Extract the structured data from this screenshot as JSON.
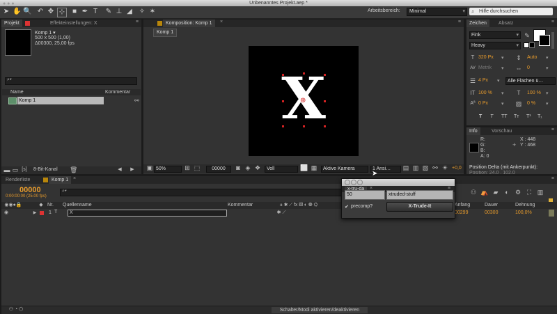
{
  "window": {
    "title": "Unbenanntes Projekt.aep *"
  },
  "toolbar": {
    "workspace_label": "Arbeitsbereich:",
    "workspace_value": "Minimal",
    "help_placeholder": "Hilfe durchsuchen"
  },
  "project_panel": {
    "tabs": [
      "Projekt",
      "Effekteinstellungen: X"
    ],
    "comp_name": "Komp 1 ▾",
    "comp_size": "500 x 500 (1,00)",
    "comp_duration": "Δ00300, 25,00 fps",
    "columns": [
      "Name",
      "Kommentar"
    ],
    "items": [
      {
        "name": "Komp 1"
      }
    ],
    "bit_depth": "8-Bit-Kanal"
  },
  "comp_panel": {
    "tab": "Komposition: Komp 1",
    "sub_tab": "Komp 1",
    "letter": "X",
    "zoom": "50%",
    "timecode": "00000",
    "quality": "Voll",
    "camera": "Aktive Kamera",
    "views": "1 Ansi…",
    "offset": "+0,0"
  },
  "character_panel": {
    "tabs": [
      "Zeichen",
      "Absatz"
    ],
    "font": "Fink",
    "style": "Heavy",
    "size": "320 Px",
    "leading": "Auto",
    "kerning": "Metrik",
    "tracking": "0",
    "stroke_width": "4 Px",
    "stroke_type": "Alle Flächen ü…",
    "vscale": "100 %",
    "hscale": "100 %",
    "baseline": "0 Px",
    "tsume": "0 %",
    "style_buttons": [
      "T",
      "T",
      "TT",
      "Tт",
      "T¹",
      "T₁"
    ]
  },
  "info_panel": {
    "tabs": [
      "Info",
      "Vorschau"
    ],
    "channels": [
      "R:",
      "G:",
      "B:",
      "A: 0"
    ],
    "x": "X : 448",
    "y": "Y : 468",
    "position_label": "Position Delta (mit Ankerpunkt):",
    "position_value": "Position: 24,0 , 102,0"
  },
  "timeline": {
    "tabs": [
      "Renderliste",
      "Komp 1"
    ],
    "timecode": "00000",
    "timecode_sub": "0:00:00:00 (25.00 fps)",
    "columns": [
      "Nr.",
      "Quellenname",
      "Kommentar",
      "Anfang",
      "Dauer",
      "Dehnung"
    ],
    "layer": {
      "number": "1",
      "name": "X",
      "in": "00299",
      "duration": "00300",
      "stretch": "100,0%"
    },
    "status": "Schalter/Modi aktivieren/deaktivieren"
  },
  "xtruda": {
    "title": "x-tru-da",
    "amount": "50",
    "name": "xtruded-stuff",
    "precomp_label": "precomp?",
    "button": "X-Trude-It"
  }
}
